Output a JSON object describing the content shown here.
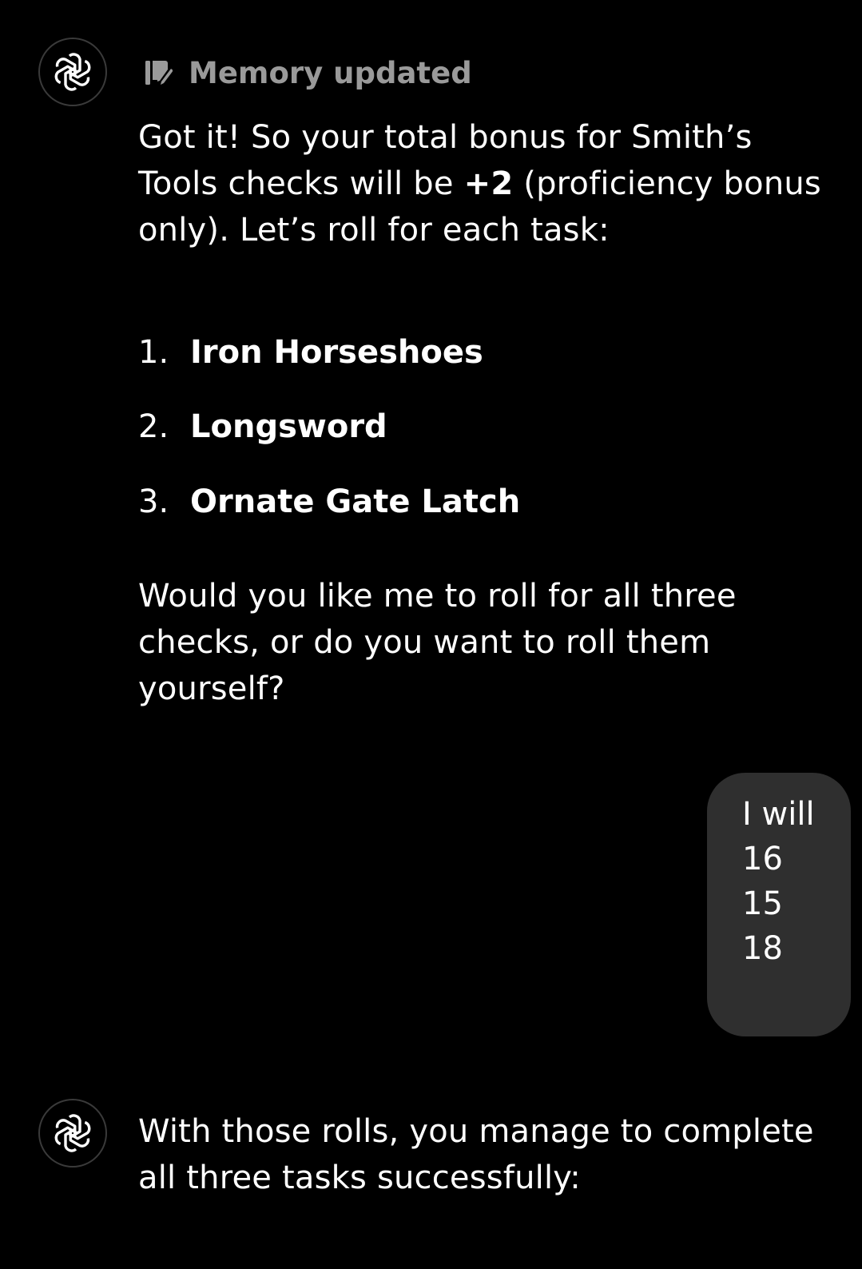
{
  "assistant_message_1": {
    "memory_label": "Memory updated",
    "intro_before_bold": "Got it! So your total bonus for Smith’s Tools checks will be ",
    "bonus_bold": "+2",
    "intro_after_bold": " (proficiency bonus only). Let’s roll for each task:",
    "tasks": [
      {
        "number": "1.",
        "title": "Iron Horseshoes"
      },
      {
        "number": "2.",
        "title": "Longsword"
      },
      {
        "number": "3.",
        "title": "Ornate Gate Latch"
      }
    ],
    "question": "Would you like me to roll for all three checks, or do you want to roll them yourself?"
  },
  "user_message": {
    "lines": [
      "I will",
      "16",
      "15",
      "18"
    ]
  },
  "assistant_message_2": {
    "text": "With those rolls, you manage to complete all three tasks successfully:"
  },
  "icons": {
    "avatar": "openai-logo-icon",
    "memory": "memory-notebook-icon"
  },
  "colors": {
    "background": "#000000",
    "bubble": "#2f2f2f",
    "muted_text": "#9a9a9a"
  }
}
